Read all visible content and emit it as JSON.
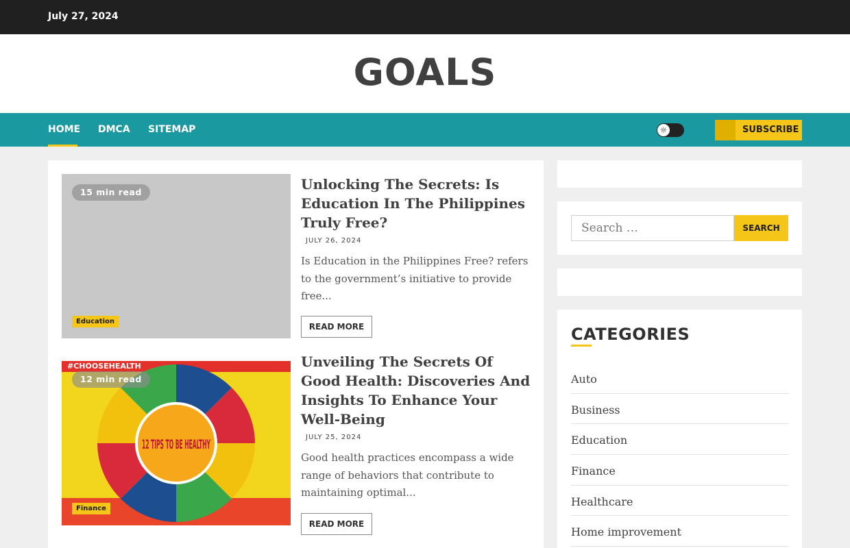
{
  "topbar": {
    "date": "July 27, 2024"
  },
  "site": {
    "title": "GOALS"
  },
  "nav": {
    "items": [
      {
        "label": "HOME"
      },
      {
        "label": "DMCA"
      },
      {
        "label": "SITEMAP"
      }
    ],
    "subscribe_label": "SUBSCRIBE"
  },
  "posts": [
    {
      "read_time": "15 min read",
      "category": "Education",
      "title": "Unlocking The Secrets: Is Education In The Philippines Truly Free?",
      "date": "JULY 26, 2024",
      "excerpt": "Is Education in the Philippines Free? refers to the government’s initiative to provide free...",
      "read_more": "READ MORE"
    },
    {
      "read_time": "12 min read",
      "category": "Finance",
      "title": "Unveiling The Secrets Of Good Health: Discoveries And Insights To Enhance Your Well-Being",
      "date": "JULY 25, 2024",
      "excerpt": "Good health practices encompass a wide range of behaviors that contribute to maintaining optimal...",
      "read_more": "READ MORE",
      "image_text": {
        "hashtag": "#CHOOSEHEALTH",
        "center": "12 TIPS TO BE HEALTHY"
      }
    }
  ],
  "sidebar": {
    "search_placeholder": "Search …",
    "search_button": "SEARCH",
    "categories_heading": "CATEGORIES",
    "categories": [
      "Auto",
      "Business",
      "Education",
      "Finance",
      "Healthcare",
      "Home improvement"
    ]
  },
  "colors": {
    "nav_bg": "#1a9aa0",
    "accent": "#f5c518",
    "topbar_bg": "#202020"
  }
}
